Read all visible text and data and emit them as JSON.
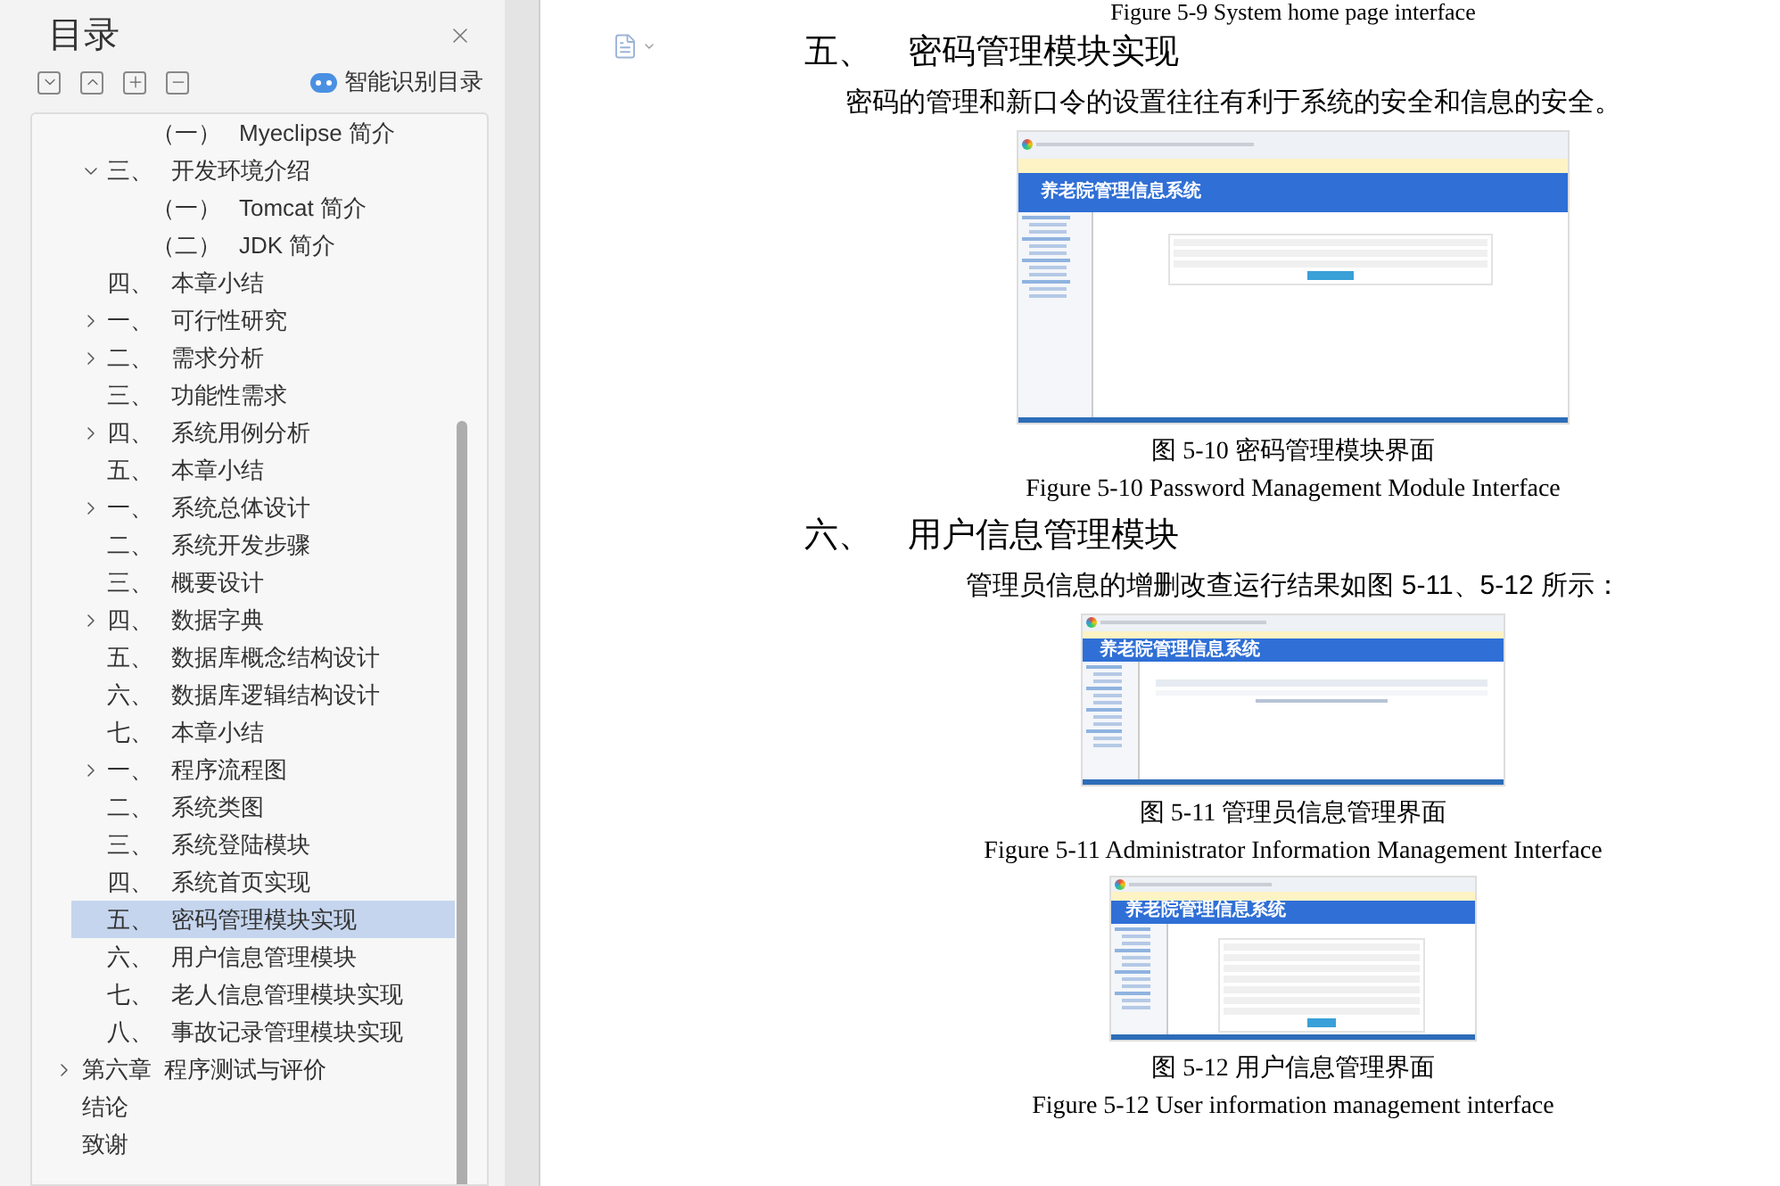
{
  "sidebar": {
    "title": "目录",
    "smart_toc_label": "智能识别目录",
    "toc": [
      {
        "kind": "subsection",
        "number": "（一）",
        "title": "Myeclipse 简介",
        "selected": false
      },
      {
        "kind": "section",
        "number": "三、",
        "title": "开发环境介绍",
        "selected": false,
        "expanded": true,
        "children": [
          {
            "kind": "subsection",
            "number": "（一）",
            "title": "Tomcat 简介",
            "selected": false
          },
          {
            "kind": "subsection",
            "number": "（二）",
            "title": "JDK 简介",
            "selected": false
          }
        ]
      },
      {
        "kind": "section",
        "number": "四、",
        "title": "本章小结",
        "selected": false
      },
      {
        "kind": "section",
        "number": "一、",
        "title": "可行性研究",
        "selected": false,
        "expanded": false
      },
      {
        "kind": "section",
        "number": "二、",
        "title": "需求分析",
        "selected": false,
        "expanded": false
      },
      {
        "kind": "section",
        "number": "三、",
        "title": "功能性需求",
        "selected": false
      },
      {
        "kind": "section",
        "number": "四、",
        "title": "系统用例分析",
        "selected": false,
        "expanded": false
      },
      {
        "kind": "section",
        "number": "五、",
        "title": "本章小结",
        "selected": false
      },
      {
        "kind": "section",
        "number": "一、",
        "title": "系统总体设计",
        "selected": false,
        "expanded": false
      },
      {
        "kind": "section",
        "number": "二、",
        "title": "系统开发步骤",
        "selected": false
      },
      {
        "kind": "section",
        "number": "三、",
        "title": "概要设计",
        "selected": false
      },
      {
        "kind": "section",
        "number": "四、",
        "title": "数据字典",
        "selected": false,
        "expanded": false
      },
      {
        "kind": "section",
        "number": "五、",
        "title": "数据库概念结构设计",
        "selected": false
      },
      {
        "kind": "section",
        "number": "六、",
        "title": "数据库逻辑结构设计",
        "selected": false
      },
      {
        "kind": "section",
        "number": "七、",
        "title": "本章小结",
        "selected": false
      },
      {
        "kind": "section",
        "number": "一、",
        "title": "程序流程图",
        "selected": false,
        "expanded": false
      },
      {
        "kind": "section",
        "number": "二、",
        "title": "系统类图",
        "selected": false
      },
      {
        "kind": "section",
        "number": "三、",
        "title": "系统登陆模块",
        "selected": false
      },
      {
        "kind": "section",
        "number": "四、",
        "title": "系统首页实现",
        "selected": false
      },
      {
        "kind": "section",
        "number": "五、",
        "title": "密码管理模块实现",
        "selected": true
      },
      {
        "kind": "section",
        "number": "六、",
        "title": "用户信息管理模块",
        "selected": false
      },
      {
        "kind": "section",
        "number": "七、",
        "title": "老人信息管理模块实现",
        "selected": false
      },
      {
        "kind": "section",
        "number": "八、",
        "title": "事故记录管理模块实现",
        "selected": false
      },
      {
        "kind": "chapter",
        "title": "第六章  程序测试与评价",
        "selected": false,
        "expanded": false
      },
      {
        "kind": "chapter",
        "title": "结论",
        "selected": false
      },
      {
        "kind": "chapter",
        "title": "致谢",
        "selected": false
      }
    ]
  },
  "document": {
    "prev_caption": "Figure 5-9 System home page interface",
    "blocks": [
      {
        "kind": "heading",
        "number": "五、",
        "title": "密码管理模块实现"
      },
      {
        "kind": "paragraph",
        "text": "密码的管理和新口令的设置往往有利于系统的安全和信息的安全。"
      },
      {
        "kind": "figure",
        "screenshot_title": "养老院管理信息系统",
        "caption_cn": "图 5-10 密码管理模块界面",
        "caption_en": "Figure 5-10 Password Management Module Interface"
      },
      {
        "kind": "heading",
        "number": "六、",
        "title": "用户信息管理模块"
      },
      {
        "kind": "paragraph",
        "text": "管理员信息的增删改查运行结果如图 5-11、5-12 所示："
      },
      {
        "kind": "figure",
        "screenshot_title": "养老院管理信息系统",
        "caption_cn": "图 5-11 管理员信息管理界面",
        "caption_en": "Figure 5-11 Administrator Information Management Interface"
      },
      {
        "kind": "figure",
        "screenshot_title": "养老院管理信息系统",
        "caption_cn": "图 5-12 用户信息管理界面",
        "caption_en": "Figure 5-12 User information management interface"
      }
    ]
  }
}
